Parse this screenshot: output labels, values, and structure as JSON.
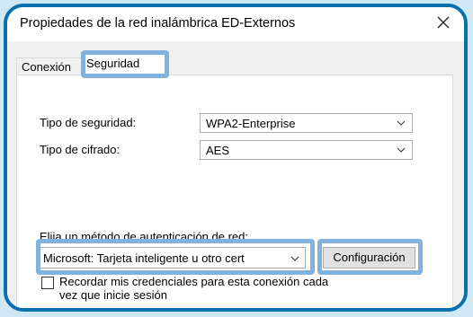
{
  "window": {
    "title": "Propiedades de la red inalámbrica ED-Externos",
    "close_icon": "close-icon"
  },
  "tabs": [
    {
      "label": "Conexión",
      "selected": false
    },
    {
      "label": "Seguridad",
      "selected": true
    }
  ],
  "security": {
    "type_label": "Tipo de seguridad:",
    "type_value": "WPA2-Enterprise",
    "cipher_label": "Tipo de cifrado:",
    "cipher_value": "AES",
    "auth_label": "Elija un método de autenticación de red:",
    "auth_value": "Microsoft: Tarjeta inteligente u otro cert",
    "config_button": "Configuración",
    "remember_line1": "Recordar mis credenciales para esta conexión cada",
    "remember_line2": "vez que inicie sesión",
    "remember_checked": false
  },
  "colors": {
    "frame_border": "#0a6fae",
    "highlight": "#7fb3de",
    "background": "#cfe8f4"
  }
}
